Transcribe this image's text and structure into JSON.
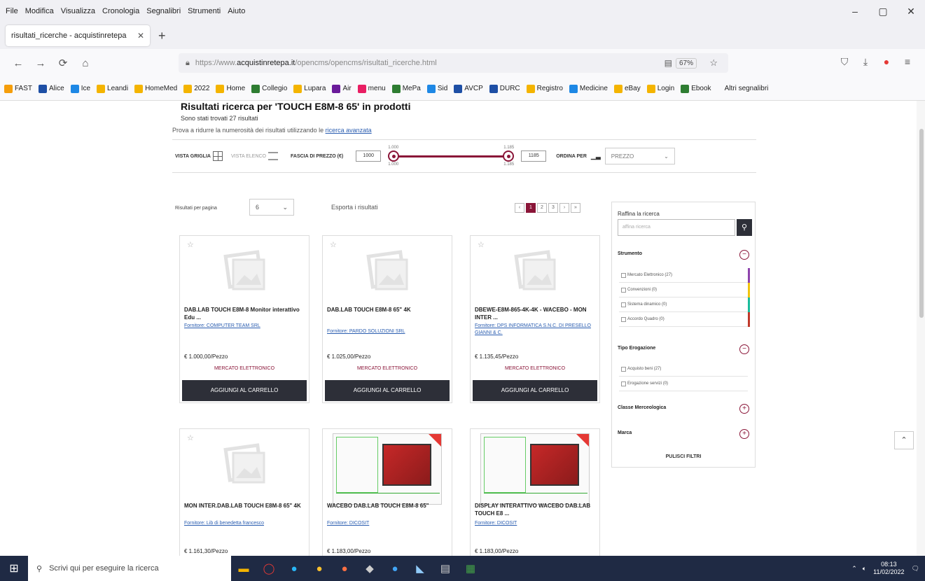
{
  "menu": [
    "File",
    "Modifica",
    "Visualizza",
    "Cronologia",
    "Segnalibri",
    "Strumenti",
    "Aiuto"
  ],
  "window_controls": {
    "minimize": "–",
    "maximize": "▢",
    "close": "✕"
  },
  "tab": {
    "title": "risultati_ricerche - acquistinretepa",
    "close": "✕",
    "new": "+"
  },
  "nav": {
    "back": "←",
    "forward": "→",
    "reload": "⟳",
    "home": "⌂"
  },
  "url": {
    "prefix": "https://www.",
    "domain": "acquistinretepa.it",
    "path": "/opencms/opencms/risultati_ricerche.html",
    "zoom": "67%"
  },
  "bookmarks": [
    {
      "label": "FAST",
      "color": "#f59e0b"
    },
    {
      "label": "Alice",
      "color": "#1e4fa5"
    },
    {
      "label": "Ice",
      "color": "#1e88e5"
    },
    {
      "label": "Leandi",
      "color": "#f4b400"
    },
    {
      "label": "HomeMed",
      "color": "#f4b400"
    },
    {
      "label": "2022",
      "color": "#f4b400"
    },
    {
      "label": "Home",
      "color": "#f4b400"
    },
    {
      "label": "Collegio",
      "color": "#2e7d32"
    },
    {
      "label": "Lupara",
      "color": "#f4b400"
    },
    {
      "label": "Air",
      "color": "#6a1b9a"
    },
    {
      "label": "menu",
      "color": "#e91e63"
    },
    {
      "label": "MePa",
      "color": "#2e7d32"
    },
    {
      "label": "Sid",
      "color": "#1e88e5"
    },
    {
      "label": "AVCP",
      "color": "#1e4fa5"
    },
    {
      "label": "DURC",
      "color": "#1e4fa5"
    },
    {
      "label": "Registro",
      "color": "#f4b400"
    },
    {
      "label": "Medicine",
      "color": "#1e88e5"
    },
    {
      "label": "eBay",
      "color": "#f4b400"
    },
    {
      "label": "Login",
      "color": "#f4b400"
    },
    {
      "label": "Ebook",
      "color": "#2e7d32"
    }
  ],
  "bookmarks_more": "Altri segnalibri",
  "page": {
    "heading": "Risultati ricerca per 'TOUCH E8M-8 65' in prodotti",
    "found": "Sono stati trovati 27 risultati",
    "hint_text": "Prova a ridurre la numerosità dei risultati utilizzando le ",
    "hint_link": "ricerca avanzata"
  },
  "toolbar": {
    "view_grid": "VISTA GRIGLIA",
    "view_list": "VISTA ELENCO",
    "price_range": "FASCIA DI PREZZO (€)",
    "price_min": "1000",
    "price_max": "1185",
    "slider_min_label": "1.000",
    "slider_max_label": "1.185",
    "slider_min_bottom": "1.000",
    "slider_max_bottom": "1.185",
    "sort_label": "ORDINA PER",
    "sort_value": "PREZZO"
  },
  "results_bar": {
    "per_page_label": "Risultati per pagina",
    "per_page_value": "6",
    "export": "Esporta i risultati",
    "pager": [
      "‹",
      "1",
      "2",
      "3",
      "›",
      "»"
    ]
  },
  "products": [
    {
      "title": "DAB.LAB TOUCH E8M-8 Monitor interattivo Edu ...",
      "supplier": "Fornitore: COMPUTER TEAM SRL",
      "price": "€ 1.000,00/Pezzo",
      "market": "MERCATO ELETTRONICO",
      "button": "AGGIUNGI AL CARRELLO"
    },
    {
      "title": "DAB.LAB TOUCH E8M-8 65\" 4K",
      "supplier": "Fornitore: PARDO SOLUZIONI SRL",
      "price": "€ 1.025,00/Pezzo",
      "market": "MERCATO ELETTRONICO",
      "button": "AGGIUNGI AL CARRELLO"
    },
    {
      "title": "DBEWE-E8M-865-4K-4K - WACEBO - MON INTER ...",
      "supplier": "Fornitore: DPS INFORMATICA S.N.C. DI PRESELLO GIANNI & C.",
      "price": "€ 1.135,45/Pezzo",
      "market": "MERCATO ELETTRONICO",
      "button": "AGGIUNGI AL CARRELLO"
    },
    {
      "title": "MON INTER.DAB.LAB TOUCH E8M-8 65\" 4K",
      "supplier": "Fornitore: Lib di benedetta francesco",
      "price": "€ 1.161,30/Pezzo"
    },
    {
      "title": "WACEBO DAB.LAB TOUCH E8M-8 65\"",
      "supplier": "Fornitore: DICOSIT",
      "price": "€ 1.183,00/Pezzo"
    },
    {
      "title": "DISPLAY INTERATTIVO WACEBO DAB.LAB TOUCH E8 ...",
      "supplier": "Fornitore: DICOSIT",
      "price": "€ 1.183,00/Pezzo"
    }
  ],
  "sidebar": {
    "title": "Raffina la ricerca",
    "search_placeholder": "affina ricerca",
    "sec_strumento": "Strumento",
    "strumento": [
      "Mercato Elettronico (27)",
      "Convenzioni (0)",
      "Sistema dinamico (0)",
      "Accordo Quadro (0)"
    ],
    "strumento_colors": [
      "#8e44ad",
      "#f1c40f",
      "#1abc9c",
      "#c0392b"
    ],
    "sec_tipo": "Tipo Erogazione",
    "tipo": [
      "Acquisto beni (27)",
      "Erogazione servizi (0)"
    ],
    "sec_classe": "Classe Merceologica",
    "sec_marca": "Marca",
    "reset": "PULISCI FILTRI"
  },
  "taskbar": {
    "search": "Scrivi qui per eseguire la ricerca",
    "time": "08:13",
    "date": "11/02/2022"
  }
}
